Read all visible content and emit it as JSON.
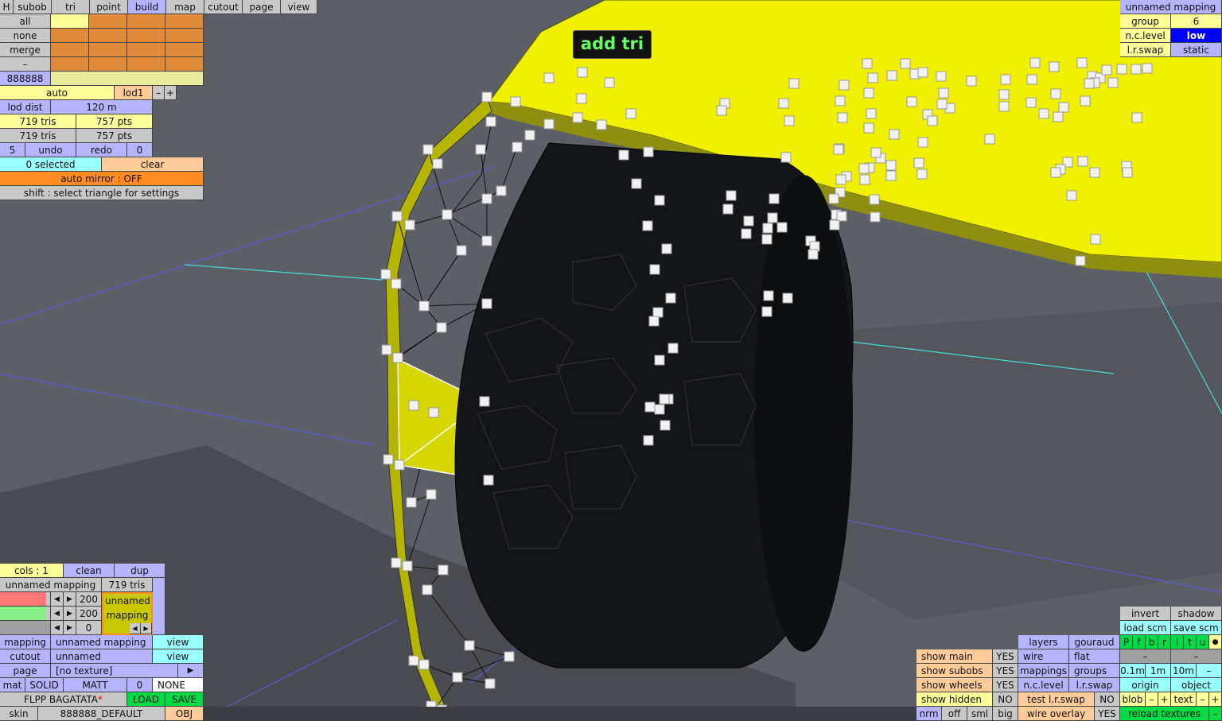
{
  "tabs": [
    "H",
    "subob",
    "tri",
    "point",
    "build",
    "map",
    "cutout",
    "page",
    "view"
  ],
  "select_panel": {
    "all": "all",
    "none": "none",
    "merge": "merge",
    "minus": "–",
    "color_value": "888888"
  },
  "lod": {
    "auto": "auto",
    "lod": "lod1",
    "minus": "–",
    "plus": "+",
    "lod_dist_label": "lod dist",
    "lod_dist_value": "120 m",
    "tris1": "719 tris",
    "pts1": "757 pts",
    "tris2": "719 tris",
    "pts2": "757 pts"
  },
  "undo": {
    "undo_count": "5",
    "undo": "undo",
    "redo": "redo",
    "redo_count": "0"
  },
  "selection": {
    "selected": "0 selected",
    "clear": "clear",
    "auto_mirror": "auto mirror : OFF",
    "hint": "shift : select triangle for settings"
  },
  "tooltip": "add tri",
  "top_right": {
    "mapping_name": "unnamed mapping",
    "group_label": "group",
    "group_value": "6",
    "nc_label": "n.c.level",
    "nc_value": "low",
    "lr_label": "l.r.swap",
    "lr_value": "static"
  },
  "cols_panel": {
    "cols": "cols : 1",
    "clean": "clean",
    "dup": "dup",
    "mapping_name": "unnamed mapping",
    "tris": "719 tris",
    "v1": "200",
    "v2": "200",
    "v3": "0",
    "mapping_box": "unnamed mapping"
  },
  "bottom_left": {
    "mapping_label": "mapping",
    "mapping_value": "unnamed mapping",
    "view1": "view",
    "cutout_label": "cutout",
    "cutout_value": "unnamed",
    "view2": "view",
    "page_label": "page",
    "page_value": "[no texture]",
    "page_arrow": "▶",
    "mat_label": "mat",
    "solid": "SOLID",
    "matt": "MATT",
    "mat_num": "0",
    "none": "NONE",
    "car_name": "FLPP BAGATATA",
    "asterisk": "*",
    "load": "LOAD",
    "save": "SAVE",
    "skin_label": "skin",
    "skin_value": "888888_DEFAULT",
    "obj": "OBJ"
  },
  "show_panel": [
    {
      "label": "show main",
      "value": "YES"
    },
    {
      "label": "show subobs",
      "value": "YES"
    },
    {
      "label": "show wheels",
      "value": "YES"
    },
    {
      "label": "show hidden",
      "value": "NO"
    }
  ],
  "nrm_row": {
    "nrm": "nrm",
    "off": "off",
    "sml": "sml",
    "big": "big"
  },
  "layers_panel": {
    "layers": "layers",
    "gouraud": "gouraud",
    "wire": "wire",
    "flat": "flat",
    "mappings": "mappings",
    "groups": "groups",
    "nclevel": "n.c.level",
    "lrswap": "l.r.swap",
    "test_lr": "test l.r.swap",
    "test_lr_val": "NO",
    "wire_overlay": "wire overlay",
    "wire_overlay_val": "YES"
  },
  "scene_panel": {
    "invert": "invert",
    "shadow": "shadow",
    "load_scm": "load scm",
    "save_scm": "save scm",
    "letters": [
      "P",
      "f",
      "b",
      "r",
      "l",
      "t",
      "u"
    ],
    "dot": "●",
    "m1": "–",
    "m2": "–",
    "grid1": "0.1m",
    "grid2": "1m",
    "grid3": "10m",
    "m3": "–",
    "origin": "origin",
    "object": "object",
    "blob": "blob",
    "text": "text",
    "reload": "reload textures"
  },
  "colors": {
    "selected_tab": "#b4b4ff",
    "body_yellow": "#f0f000",
    "green_text": "#66ff66"
  }
}
